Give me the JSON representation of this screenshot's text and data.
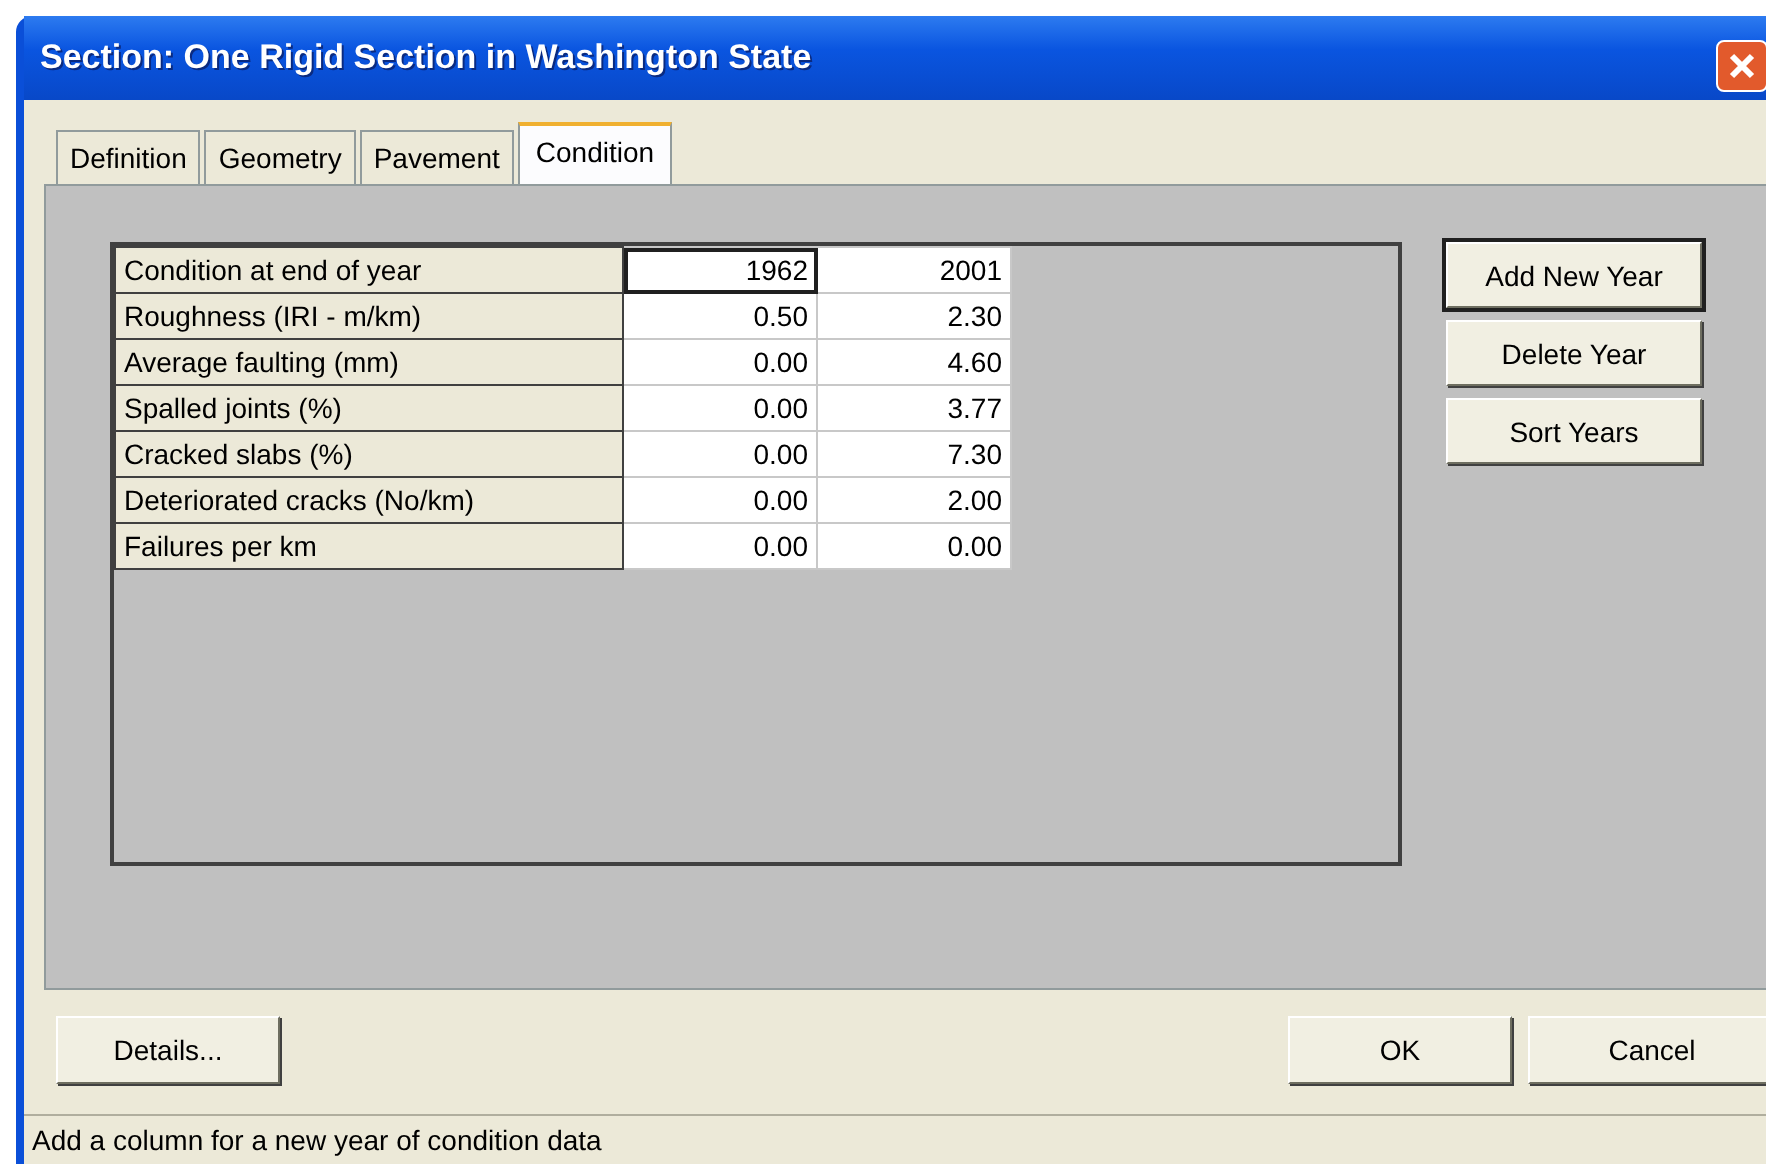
{
  "window": {
    "title": "Section: One Rigid Section in Washington State"
  },
  "tabs": [
    {
      "label": "Definition",
      "selected": false
    },
    {
      "label": "Geometry",
      "selected": false
    },
    {
      "label": "Pavement",
      "selected": false
    },
    {
      "label": "Condition",
      "selected": true
    }
  ],
  "grid": {
    "rows": [
      {
        "label": "Condition at end of year",
        "values": [
          "1962",
          "2001"
        ],
        "selected": [
          true,
          false
        ]
      },
      {
        "label": "Roughness (IRI - m/km)",
        "values": [
          "0.50",
          "2.30"
        ]
      },
      {
        "label": "Average faulting (mm)",
        "values": [
          "0.00",
          "4.60"
        ]
      },
      {
        "label": "Spalled joints (%)",
        "values": [
          "0.00",
          "3.77"
        ]
      },
      {
        "label": "Cracked slabs (%)",
        "values": [
          "0.00",
          "7.30"
        ]
      },
      {
        "label": "Deteriorated cracks (No/km)",
        "values": [
          "0.00",
          "2.00"
        ]
      },
      {
        "label": "Failures per km",
        "values": [
          "0.00",
          "0.00"
        ]
      }
    ]
  },
  "side_buttons": [
    {
      "label": "Add New Year",
      "default": true
    },
    {
      "label": "Delete Year",
      "default": false
    },
    {
      "label": "Sort Years",
      "default": false
    }
  ],
  "footer": {
    "left_button": "Details...",
    "ok": "OK",
    "cancel": "Cancel"
  },
  "status_bar": "Add a column for a new year of condition data"
}
